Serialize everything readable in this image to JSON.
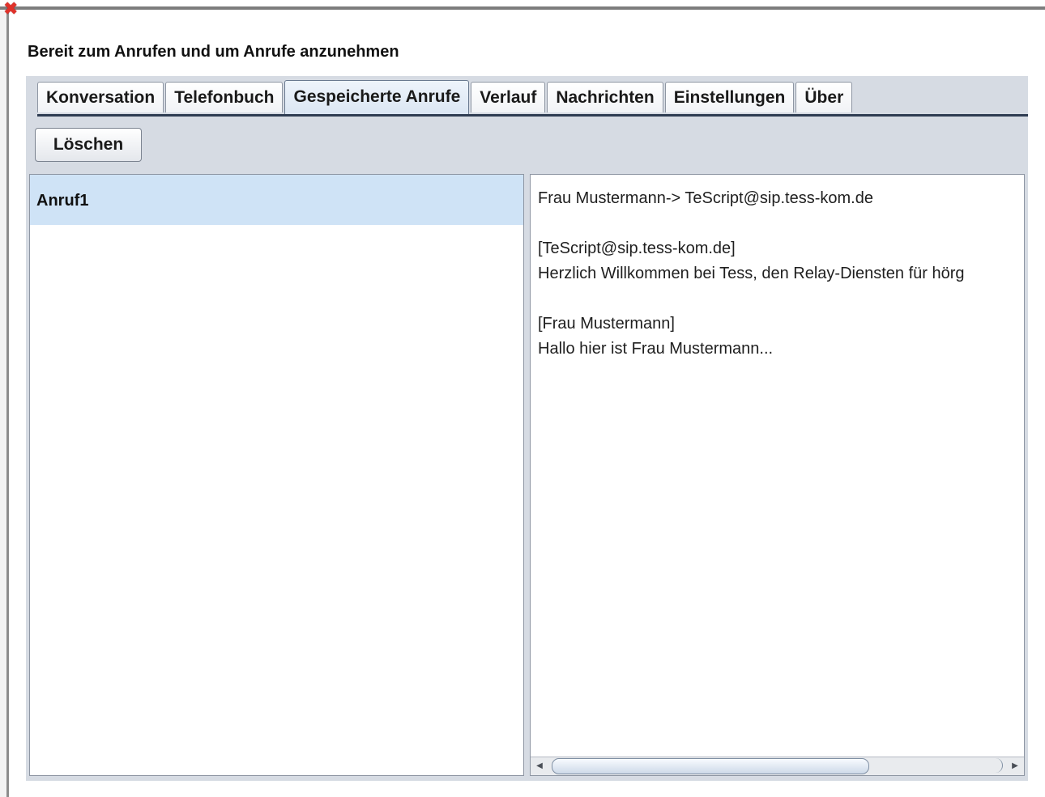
{
  "window": {
    "close_icon": "close-icon",
    "status_text": "Bereit zum Anrufen und um Anrufe anzunehmen"
  },
  "tabs": [
    {
      "label": "Konversation",
      "active": false
    },
    {
      "label": "Telefonbuch",
      "active": false
    },
    {
      "label": "Gespeicherte Anrufe",
      "active": true
    },
    {
      "label": "Verlauf",
      "active": false
    },
    {
      "label": "Nachrichten",
      "active": false
    },
    {
      "label": "Einstellungen",
      "active": false
    },
    {
      "label": "Über",
      "active": false
    }
  ],
  "toolbar": {
    "delete_label": "Löschen"
  },
  "calls": [
    {
      "label": "Anruf1",
      "selected": true
    }
  ],
  "transcript": {
    "lines": [
      "Frau Mustermann-> TeScript@sip.tess-kom.de",
      "",
      "[TeScript@sip.tess-kom.de]",
      "Herzlich Willkommen bei Tess, den Relay-Diensten für hörg",
      "",
      "[Frau Mustermann]",
      "Hallo hier ist Frau Mustermann..."
    ]
  },
  "colors": {
    "panel_bg": "#d6dbe3",
    "selection_bg": "#cfe3f6",
    "tab_underline": "#2f3d52",
    "close_red": "#e0322a"
  }
}
